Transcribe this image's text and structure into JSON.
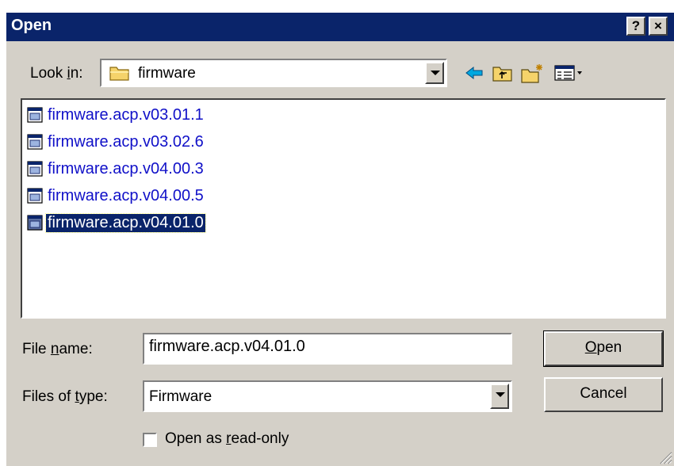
{
  "window": {
    "title": "Open",
    "help_label": "?",
    "close_label": "×"
  },
  "look_in": {
    "label_pre": "Look ",
    "label_accel": "i",
    "label_post": "n:",
    "value": "firmware",
    "folder_icon": "folder-icon"
  },
  "toolbar": {
    "back_icon": "back-arrow-icon",
    "up_icon": "up-folder-icon",
    "new_folder_icon": "new-folder-icon",
    "view_icon": "view-menu-icon"
  },
  "files": [
    {
      "name": "firmware.acp.v03.01.1",
      "selected": false
    },
    {
      "name": "firmware.acp.v03.02.6",
      "selected": false
    },
    {
      "name": "firmware.acp.v04.00.3",
      "selected": false
    },
    {
      "name": "firmware.acp.v04.00.5",
      "selected": false
    },
    {
      "name": "firmware.acp.v04.01.0",
      "selected": true
    }
  ],
  "file_name": {
    "label_pre": "File ",
    "label_accel": "n",
    "label_post": "ame:",
    "value": "firmware.acp.v04.01.0"
  },
  "file_type": {
    "label_pre": "Files of ",
    "label_accel": "t",
    "label_post": "ype:",
    "value": "Firmware"
  },
  "buttons": {
    "open_accel": "O",
    "open_rest": "pen",
    "cancel": "Cancel"
  },
  "readonly": {
    "label_pre": "Open as ",
    "label_accel": "r",
    "label_post": "ead-only",
    "checked": false
  },
  "colors": {
    "title_bar": "#0a246a",
    "face": "#d4d0c8",
    "file_text": "#1010c8",
    "selection": "#0a246a"
  }
}
